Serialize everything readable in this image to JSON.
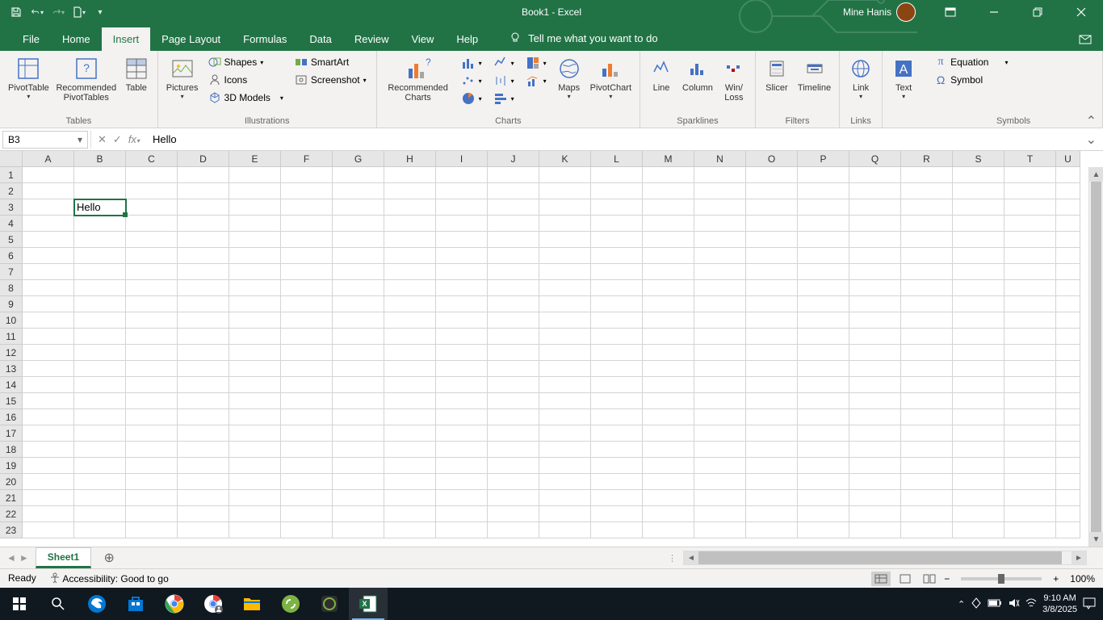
{
  "titlebar": {
    "title": "Book1  -  Excel",
    "user": "Mine Hanis"
  },
  "tabs": [
    "File",
    "Home",
    "Insert",
    "Page Layout",
    "Formulas",
    "Data",
    "Review",
    "View",
    "Help"
  ],
  "active_tab": "Insert",
  "tellme": "Tell me what you want to do",
  "ribbon": {
    "tables": {
      "label": "Tables",
      "pivot": "PivotTable",
      "recommended": "Recommended PivotTables",
      "table": "Table"
    },
    "illustrations": {
      "label": "Illustrations",
      "pictures": "Pictures",
      "shapes": "Shapes",
      "icons": "Icons",
      "models": "3D Models",
      "smartart": "SmartArt",
      "screenshot": "Screenshot"
    },
    "charts": {
      "label": "Charts",
      "recommended": "Recommended Charts",
      "maps": "Maps",
      "pivotchart": "PivotChart"
    },
    "sparklines": {
      "label": "Sparklines",
      "line": "Line",
      "column": "Column",
      "winloss": "Win/\nLoss"
    },
    "filters": {
      "label": "Filters",
      "slicer": "Slicer",
      "timeline": "Timeline"
    },
    "links": {
      "label": "Links",
      "link": "Link"
    },
    "text": {
      "label": "",
      "text": "Text"
    },
    "symbols": {
      "label": "Symbols",
      "equation": "Equation",
      "symbol": "Symbol"
    }
  },
  "formula_bar": {
    "name_box": "B3",
    "formula": "Hello"
  },
  "columns": [
    "A",
    "B",
    "C",
    "D",
    "E",
    "F",
    "G",
    "H",
    "I",
    "J",
    "K",
    "L",
    "M",
    "N",
    "O",
    "P",
    "Q",
    "R",
    "S",
    "T",
    "U"
  ],
  "rows": 23,
  "cells": {
    "B3": "Hello"
  },
  "selected": "B3",
  "sheet": "Sheet1",
  "status": {
    "ready": "Ready",
    "accessibility": "Accessibility: Good to go",
    "zoom": "100%"
  },
  "taskbar": {
    "time": "9:10 AM",
    "date": "3/8/2025"
  }
}
